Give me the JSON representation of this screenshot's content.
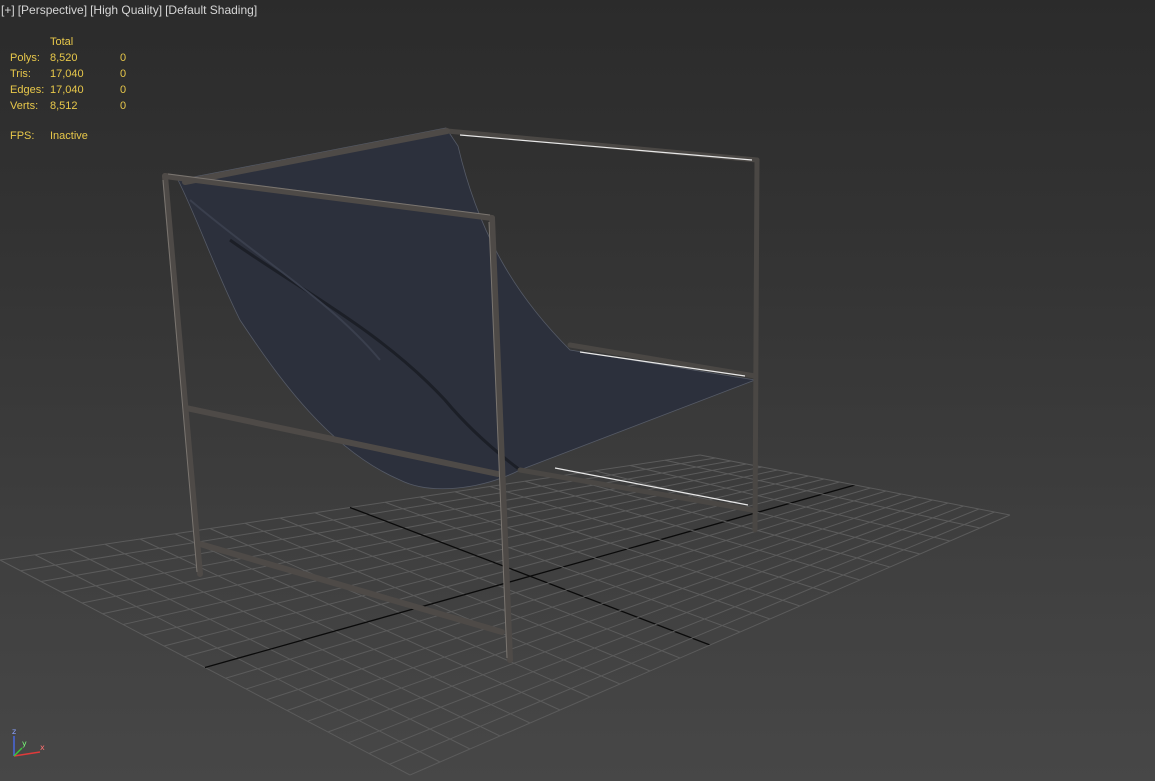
{
  "viewport": {
    "labels": [
      "[+]",
      "[Perspective]",
      "[High Quality]",
      "[Default Shading]"
    ]
  },
  "stats": {
    "header": "Total",
    "rows": [
      {
        "label": "Polys:",
        "total": "8,520",
        "selected": "0"
      },
      {
        "label": "Tris:",
        "total": "17,040",
        "selected": "0"
      },
      {
        "label": "Edges:",
        "total": "17,040",
        "selected": "0"
      },
      {
        "label": "Verts:",
        "total": "8,512",
        "selected": "0"
      }
    ],
    "fps_label": "FPS:",
    "fps_value": "Inactive"
  },
  "scene": {
    "object": "sling lounge chair",
    "frame_color": "#4a4744",
    "fabric_color": "#2c303c",
    "grid_color": "#5b5b5b"
  },
  "axis_tripod": {
    "x_label": "x",
    "y_label": "y",
    "z_label": "z",
    "x_color": "#e03a3a",
    "y_color": "#3ac83a",
    "z_color": "#4a6ae8"
  }
}
